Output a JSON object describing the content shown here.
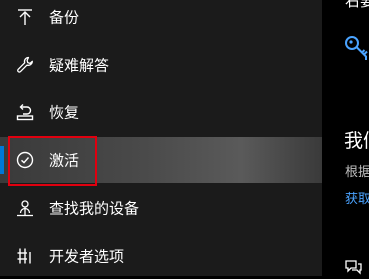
{
  "sidebar": {
    "items": [
      {
        "label": "备份",
        "icon": "arrow-up-icon"
      },
      {
        "label": "疑难解答",
        "icon": "wrench-icon"
      },
      {
        "label": "恢复",
        "icon": "recovery-icon"
      },
      {
        "label": "激活",
        "icon": "check-circle-icon",
        "selected": true
      },
      {
        "label": "查找我的设备",
        "icon": "person-location-icon"
      },
      {
        "label": "开发者选项",
        "icon": "developer-icon"
      }
    ]
  },
  "main": {
    "top_text": "右要",
    "heading": "我们",
    "body_text": "根据",
    "link_text": "获取"
  },
  "colors": {
    "accent": "#0078d7",
    "highlight_border": "#e0000f",
    "link": "#4aa3ff",
    "sidebar_bg": "#1b1b1b",
    "main_bg": "#000000"
  }
}
